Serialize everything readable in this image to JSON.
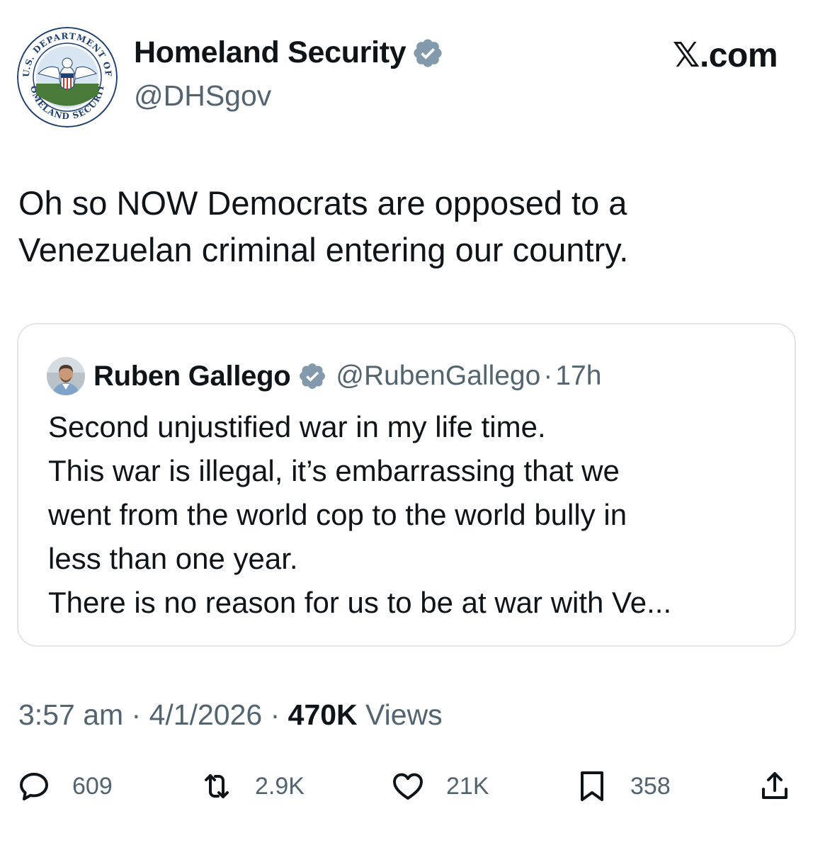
{
  "author": {
    "display_name": "Homeland Security",
    "handle": "@DHSgov",
    "seal_text_top": "U.S. DEPARTMENT OF",
    "seal_text_bottom": "HOMELAND SECURITY"
  },
  "brand": "𝕏.com",
  "tweet": {
    "lines": [
      "Oh so NOW Democrats are opposed to a",
      "Venezuelan criminal entering our country."
    ]
  },
  "quote": {
    "display_name": "Ruben Gallego",
    "handle": "@RubenGallego",
    "separator": "·",
    "time": "17h",
    "lines": [
      "Second unjustified war in my life time.",
      "This war is illegal, it’s embarrassing that we",
      "went from the world cop to the world bully in",
      "less than one year.",
      "There is no reason for us to be at war with Ve..."
    ]
  },
  "meta": {
    "time": "3:57 am",
    "sep1": " · ",
    "date": "4/1/2026",
    "sep2": " · ",
    "views_count": "470K",
    "views_label": " Views"
  },
  "actions": {
    "replies": "609",
    "reposts": "2.9K",
    "likes": "21K",
    "bookmarks": "358"
  },
  "colors": {
    "text_primary": "#0f1419",
    "text_secondary": "#536471",
    "border": "#e1e5e9",
    "verified_badge": "#829aab"
  },
  "icons": {
    "verified": "verified-badge-icon",
    "reply": "reply-icon",
    "repost": "repost-icon",
    "like": "heart-icon",
    "bookmark": "bookmark-icon",
    "share": "share-icon"
  }
}
